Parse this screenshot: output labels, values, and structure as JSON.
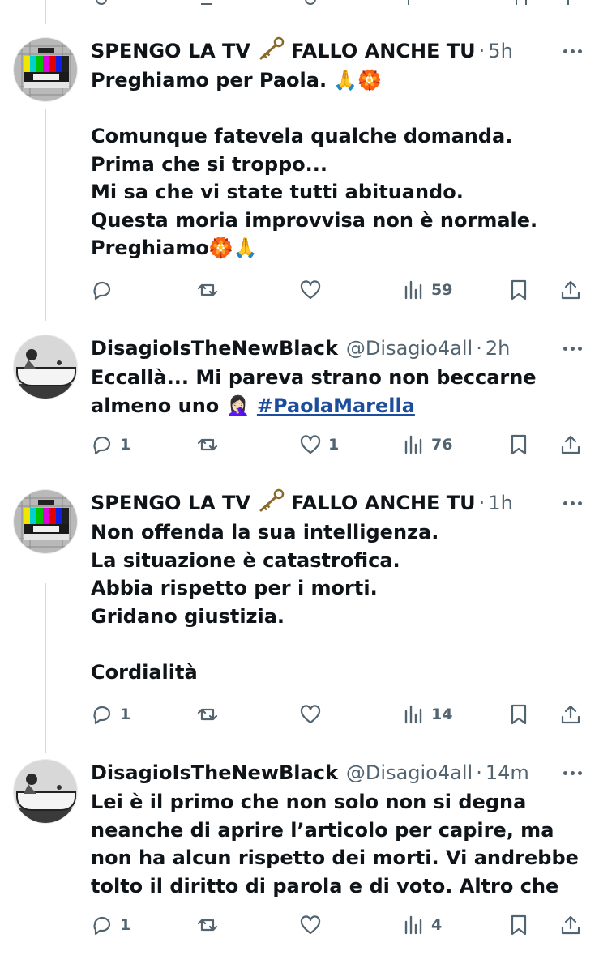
{
  "tweets": [
    {
      "name_left": "SPENGO LA TV",
      "name_right": "FALLO ANCHE TU",
      "handle": "",
      "time": "5h",
      "lines": [
        "Preghiamo per Paola. 🙏🏵️",
        "",
        "Comunque fatevela qualche domanda.",
        "Prima che si troppo...",
        "Mi sa che vi state tutti abituando.",
        "Questa moria improvvisa non è normale.",
        "Preghiamo🏵️🙏"
      ],
      "replies": "",
      "retweets": "",
      "likes": "",
      "views": "59"
    },
    {
      "name": "DisagioIsTheNewBlack",
      "handle": "@Disagio4all",
      "time": "2h",
      "lines": [
        "Eccallà... Mi pareva strano non beccarne",
        "almeno uno 🤦🏻‍♀️"
      ],
      "hashtag": "#PaolaMarella",
      "replies": "1",
      "retweets": "",
      "likes": "1",
      "views": "76"
    },
    {
      "name_left": "SPENGO LA TV",
      "name_right": "FALLO ANCHE TU",
      "handle": "",
      "time": "1h",
      "lines": [
        "Non offenda la sua intelligenza.",
        "La situazione è catastrofica.",
        "Abbia rispetto per i morti.",
        "Gridano giustizia.",
        "",
        "Cordialità"
      ],
      "replies": "1",
      "retweets": "",
      "likes": "",
      "views": "14"
    },
    {
      "name": "DisagioIsTheNewBlack",
      "handle": "@Disagio4all",
      "time": "14m",
      "lines": [
        "Lei è il primo che non solo non si degna",
        "neanche di aprire l’articolo per capire, ma",
        "non ha alcun rispetto dei morti. Vi andrebbe",
        "tolto il diritto di parola e di voto. Altro che"
      ],
      "replies": "1",
      "retweets": "",
      "likes": "",
      "views": "4"
    }
  ],
  "icons": {
    "reply": "reply-icon",
    "retweet": "retweet-icon",
    "like": "like-icon",
    "views": "views-icon",
    "bookmark": "bookmark-icon",
    "share": "share-icon",
    "more": "more-icon",
    "key": "key-icon"
  },
  "colors": {
    "text": "#0f1419",
    "secondary": "#536471",
    "hashtag": "#1d4e9e",
    "thread_line": "#cfd9de"
  }
}
